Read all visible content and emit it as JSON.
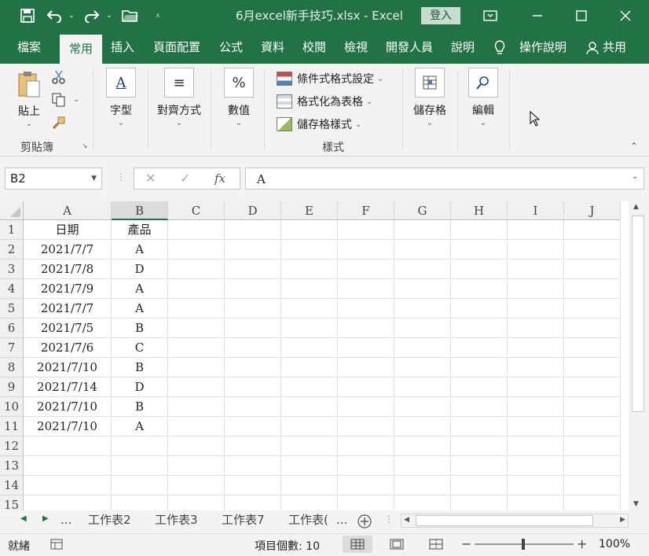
{
  "window": {
    "title": "6月excel新手技巧.xlsx  -  Excel",
    "signin": "登入"
  },
  "menu": {
    "tabs": [
      "檔案",
      "常用",
      "插入",
      "頁面配置",
      "公式",
      "資料",
      "校閱",
      "檢視",
      "開發人員",
      "說明"
    ],
    "tell_me": "操作說明",
    "share": "共用"
  },
  "ribbon": {
    "clipboard": {
      "paste": "貼上",
      "group": "剪貼簿"
    },
    "font": "字型",
    "alignment": "對齊方式",
    "number": "數值",
    "styles": {
      "conditional": "條件式格式設定",
      "as_table": "格式化為表格",
      "cell_styles": "儲存格樣式",
      "group": "樣式"
    },
    "cells": "儲存格",
    "editing": "編輯"
  },
  "formula_bar": {
    "name_box": "B2",
    "fx": "fx",
    "content": "A"
  },
  "sheet": {
    "columns": [
      "A",
      "B",
      "C",
      "D",
      "E",
      "F",
      "G",
      "H",
      "I",
      "J"
    ],
    "row_numbers": [
      "1",
      "2",
      "3",
      "4",
      "5",
      "6",
      "7",
      "8",
      "9",
      "10",
      "11",
      "12",
      "13",
      "14",
      "15"
    ],
    "rows": [
      [
        "日期",
        "產品"
      ],
      [
        "2021/7/7",
        "A"
      ],
      [
        "2021/7/8",
        "D"
      ],
      [
        "2021/7/9",
        "A"
      ],
      [
        "2021/7/7",
        "A"
      ],
      [
        "2021/7/5",
        "B"
      ],
      [
        "2021/7/6",
        "C"
      ],
      [
        "2021/7/10",
        "B"
      ],
      [
        "2021/7/14",
        "D"
      ],
      [
        "2021/7/10",
        "B"
      ],
      [
        "2021/7/10",
        "A"
      ]
    ]
  },
  "sheet_tabs": {
    "ellipsis": "...",
    "tabs": [
      "工作表2",
      "工作表3",
      "工作表7",
      "工作表("
    ],
    "more": "..."
  },
  "status": {
    "ready": "就緒",
    "count": "項目個數: 10",
    "zoom": "100%"
  },
  "colors": {
    "accent": "#217346"
  }
}
